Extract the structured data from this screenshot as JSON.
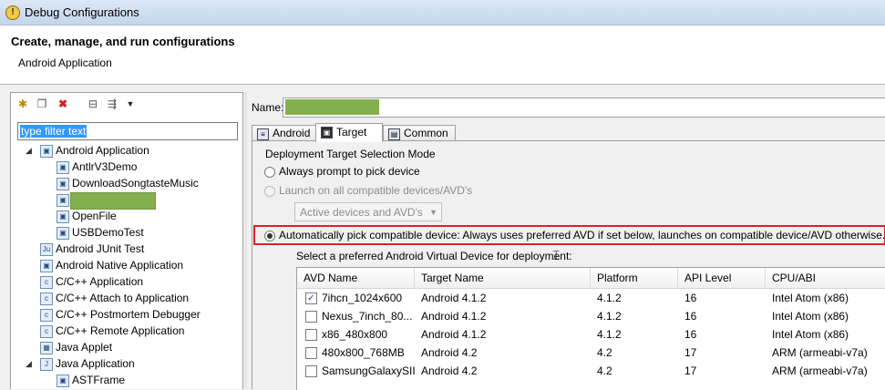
{
  "window": {
    "title": "Debug Configurations"
  },
  "header": {
    "title": "Create, manage, and run configurations",
    "subtitle": "Android Application"
  },
  "left": {
    "filter_text": "type filter text",
    "tree": [
      {
        "label": "Android Application",
        "level": 1,
        "expanded": true,
        "icon": "android-app-icon"
      },
      {
        "label": "AntlrV3Demo",
        "level": 2,
        "icon": "config-icon"
      },
      {
        "label": "DownloadSongtasteMusic",
        "level": 2,
        "icon": "config-icon"
      },
      {
        "label": "",
        "level": 2,
        "icon": "config-icon",
        "redacted": true
      },
      {
        "label": "OpenFile",
        "level": 2,
        "icon": "config-icon"
      },
      {
        "label": "USBDemoTest",
        "level": 2,
        "icon": "config-icon"
      },
      {
        "label": "Android JUnit Test",
        "level": 1,
        "icon": "junit-icon"
      },
      {
        "label": "Android Native Application",
        "level": 1,
        "icon": "android-app-icon"
      },
      {
        "label": "C/C++ Application",
        "level": 1,
        "icon": "c-icon"
      },
      {
        "label": "C/C++ Attach to Application",
        "level": 1,
        "icon": "c-icon"
      },
      {
        "label": "C/C++ Postmortem Debugger",
        "level": 1,
        "icon": "c-icon"
      },
      {
        "label": "C/C++ Remote Application",
        "level": 1,
        "icon": "c-icon"
      },
      {
        "label": "Java Applet",
        "level": 1,
        "icon": "applet-icon"
      },
      {
        "label": "Java Application",
        "level": 1,
        "expanded": true,
        "icon": "java-icon"
      },
      {
        "label": "ASTFrame",
        "level": 2,
        "icon": "config-icon"
      }
    ]
  },
  "right": {
    "name_label": "Name:",
    "tabs": [
      {
        "label": "Android",
        "active": false
      },
      {
        "label": "Target",
        "active": true
      },
      {
        "label": "Common",
        "active": false
      }
    ],
    "group_title": "Deployment Target Selection Mode",
    "options": {
      "always_prompt": "Always prompt to pick device",
      "launch_all": "Launch on all compatible devices/AVD's",
      "combo_value": "Active devices and AVD's",
      "automatic": "Automatically pick compatible device: Always uses preferred AVD if set below, launches on compatible device/AVD otherwise."
    },
    "avd_caption": "Select a preferred Android Virtual Device for deployment:",
    "table": {
      "headers": [
        "AVD Name",
        "Target Name",
        "Platform",
        "API Level",
        "CPU/ABI"
      ],
      "rows": [
        {
          "checked": true,
          "cells": [
            "7ihcn_1024x600",
            "Android 4.1.2",
            "4.1.2",
            "16",
            "Intel Atom (x86)"
          ]
        },
        {
          "checked": false,
          "cells": [
            "Nexus_7inch_80...",
            "Android 4.1.2",
            "4.1.2",
            "16",
            "Intel Atom (x86)"
          ]
        },
        {
          "checked": false,
          "cells": [
            "x86_480x800",
            "Android 4.1.2",
            "4.1.2",
            "16",
            "Intel Atom (x86)"
          ]
        },
        {
          "checked": false,
          "cells": [
            "480x800_768MB",
            "Android 4.2",
            "4.2",
            "17",
            "ARM (armeabi-v7a)"
          ]
        },
        {
          "checked": false,
          "cells": [
            "SamsungGalaxySII",
            "Android 4.2",
            "4.2",
            "17",
            "ARM (armeabi-v7a)"
          ]
        }
      ]
    }
  },
  "colors": {
    "highlight_border": "#e0202a",
    "redaction": "#85b04f",
    "selection": "#3399ff"
  }
}
